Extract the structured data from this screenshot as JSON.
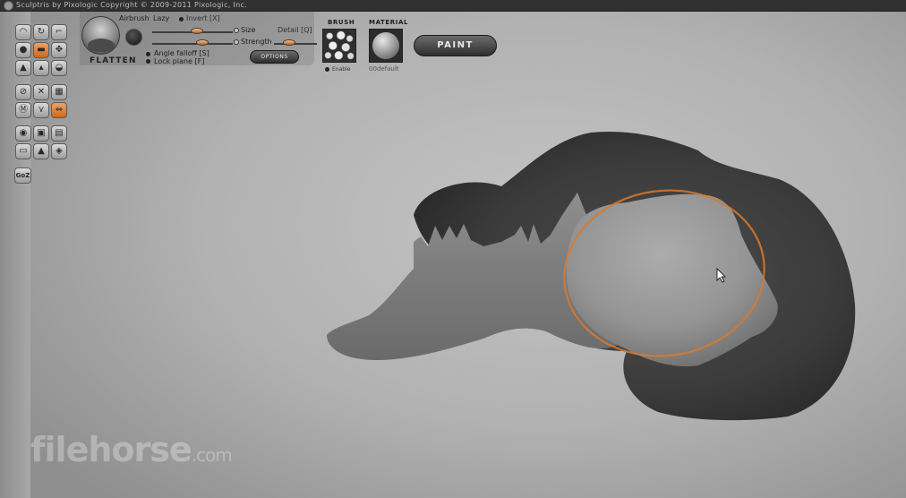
{
  "title_bar": {
    "text": "Sculptris by Pixologic   Copyright © 2009-2011 Pixologic, Inc."
  },
  "tools": [
    {
      "icon": "draw-icon",
      "active": false
    },
    {
      "icon": "rotate-icon",
      "active": false
    },
    {
      "icon": "scale-icon",
      "active": false
    },
    {
      "icon": "inflate-icon",
      "active": false
    },
    {
      "icon": "flatten-icon",
      "active": true
    },
    {
      "icon": "grab-icon",
      "active": false
    },
    {
      "icon": "crease-icon",
      "active": false
    },
    {
      "icon": "pinch-icon",
      "active": false
    },
    {
      "icon": "smooth-icon",
      "active": false
    },
    {
      "icon": "mask-icon",
      "active": false
    },
    {
      "icon": "reduce-brush-icon",
      "active": false
    },
    {
      "icon": "reduce-selected-icon",
      "active": false
    },
    {
      "icon": "wireframe-icon",
      "active": false
    },
    {
      "icon": "symmetry-icon",
      "active": false
    },
    {
      "icon": "mirror-icon",
      "active": true
    },
    {
      "icon": "sphere-icon",
      "active": false
    },
    {
      "icon": "camera-front-icon",
      "active": false
    },
    {
      "icon": "camera-side-icon",
      "active": false
    },
    {
      "icon": "plane-icon",
      "active": false
    },
    {
      "icon": "fill-icon",
      "active": false
    },
    {
      "icon": "hide-icon",
      "active": false
    }
  ],
  "goz_label": "GoZ",
  "brush": {
    "name": "FLATTEN",
    "airbrush_label": "Airbrush",
    "lazy_label": "Lazy",
    "invert_label": "Invert [X]",
    "size_label": "Size",
    "detail_label": "Detail [Q]",
    "strength_label": "Strength",
    "angle_falloff_label": "Angle falloff [S]",
    "lock_plane_label": "Lock plane [F]",
    "options_label": "OPTIONS",
    "size_value": 0.55,
    "strength_value": 0.62,
    "detail_value": 0.35
  },
  "brush_panel": {
    "header": "BRUSH",
    "enable_label": "Enable"
  },
  "material_panel": {
    "header": "MATERIAL",
    "name": "00default"
  },
  "paint_label": "PAINT",
  "watermark": {
    "main": "filehorse",
    "suffix": ".com"
  },
  "colors": {
    "accent": "#d87a2e",
    "active_tool": "#e0853c",
    "model_dark": "#3c3c3c",
    "model_light": "#8c8c8c"
  }
}
